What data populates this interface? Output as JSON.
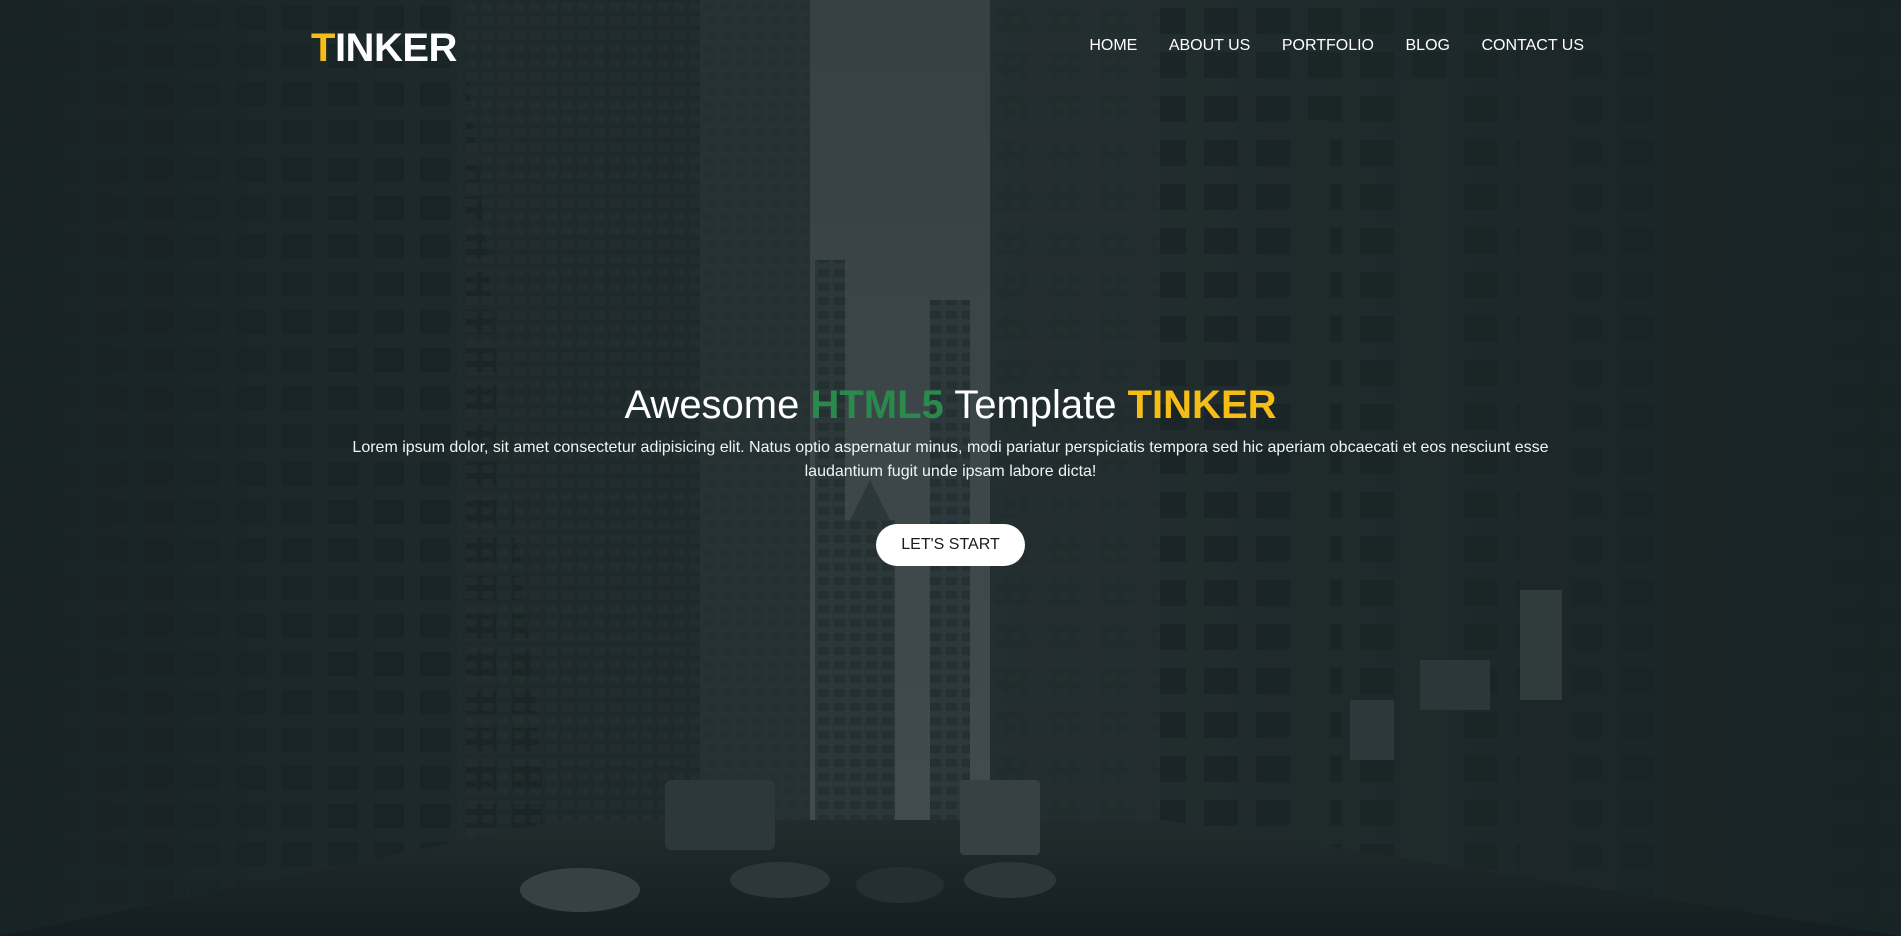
{
  "brand": {
    "logo_first_letter": "T",
    "logo_rest": "INKER",
    "accent_color": "#f5bd16"
  },
  "nav": {
    "items": [
      {
        "label": "HOME"
      },
      {
        "label": "ABOUT US"
      },
      {
        "label": "PORTFOLIO"
      },
      {
        "label": "BLOG"
      },
      {
        "label": "CONTACT US"
      }
    ]
  },
  "hero": {
    "headline_part1": "Awesome ",
    "headline_green": "HTML5",
    "headline_part2": " Template ",
    "headline_yellow": "TINKER",
    "green_color": "#2a8a4c",
    "yellow_color": "#f5bd16",
    "subtitle": "Lorem ipsum dolor, sit amet consectetur adipisicing elit. Natus optio aspernatur minus, modi pariatur perspiciatis tempora sed hic aperiam obcaecati et eos nesciunt esse laudantium fugit unde ipsam labore dicta!",
    "cta_label": "LET'S START",
    "background_icon": "city-street-photo"
  }
}
